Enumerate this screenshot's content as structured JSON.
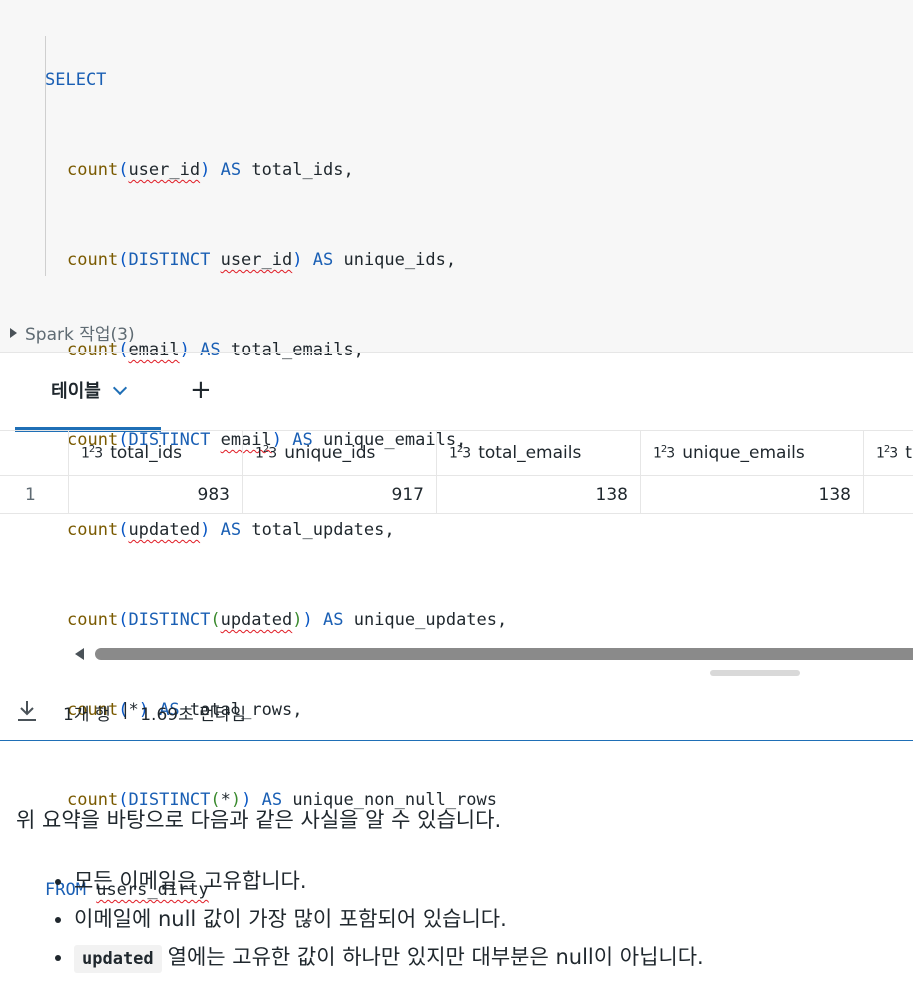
{
  "code": {
    "select": "SELECT",
    "from": "FROM",
    "table": "users_dirty",
    "as": "AS",
    "count": "count",
    "distinct": "DISTINCT",
    "lines": [
      {
        "arg": "user_id",
        "distinct": false,
        "alias": "total_ids,"
      },
      {
        "arg": "user_id",
        "distinct": true,
        "alias": "unique_ids,"
      },
      {
        "arg": "email",
        "distinct": false,
        "alias": "total_emails,"
      },
      {
        "arg": "email",
        "distinct": true,
        "alias": "unique_emails,"
      },
      {
        "arg": "updated",
        "distinct": false,
        "alias": "total_updates,"
      },
      {
        "arg": "updated",
        "distinct": true,
        "alias": "unique_updates,"
      },
      {
        "arg": "*",
        "distinct": false,
        "alias": "total_rows,"
      },
      {
        "arg": "*",
        "distinct": true,
        "alias": "unique_non_null_rows"
      }
    ]
  },
  "spark_jobs": "Spark 작업(3)",
  "tabs": {
    "table_label": "테이블",
    "add_label": "+"
  },
  "grid": {
    "type_icon": "123",
    "columns": [
      "total_ids",
      "unique_ids",
      "total_emails",
      "unique_emails",
      "t"
    ],
    "rows": [
      {
        "index": "1",
        "values": [
          "983",
          "917",
          "138",
          "138",
          ""
        ]
      }
    ]
  },
  "footer": {
    "rows": "1개 행",
    "sep": "|",
    "runtime": "1.69초 런타임"
  },
  "markdown": {
    "intro": "위 요약을 바탕으로 다음과 같은 사실을 알 수 있습니다.",
    "bullets": {
      "b1": "모든 이메일은 고유합니다.",
      "b2": "이메일에 null 값이 가장 많이 포함되어 있습니다.",
      "b3_code": "updated",
      "b3_text": "열에는 고유한 값이 하나만 있지만 대부분은 null이 아닙니다."
    }
  }
}
